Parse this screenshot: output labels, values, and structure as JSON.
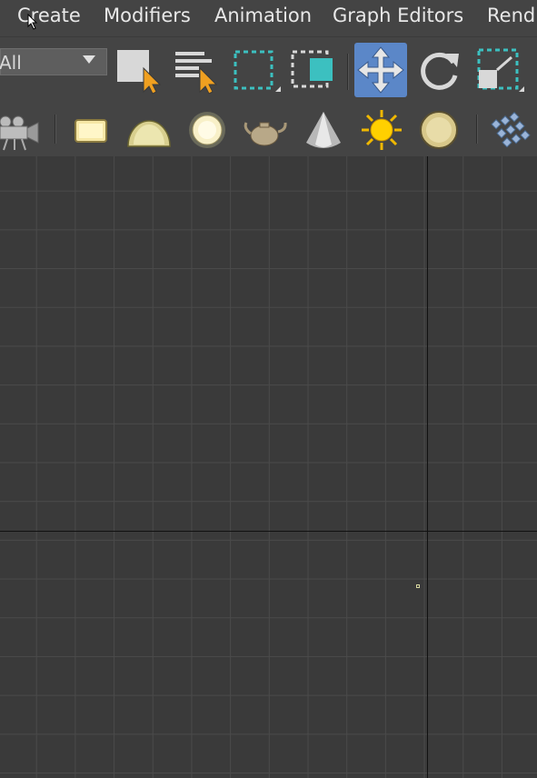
{
  "menu": {
    "items": [
      "Create",
      "Modifiers",
      "Animation",
      "Graph Editors",
      "Rend"
    ]
  },
  "toolbar": {
    "selection_filter": "All",
    "buttons": [
      "select-object-icon",
      "select-by-name-icon",
      "rectangular-selection-region-icon",
      "window-crossing-icon",
      "select-and-move-icon",
      "select-and-rotate-icon",
      "select-and-scale-icon"
    ],
    "active_button": "select-and-move-icon",
    "accent_color": "#5b87c8"
  },
  "create_toolbar": {
    "icons": [
      "camera-icon",
      "free-light-icon",
      "skylight-icon",
      "omni-light-icon",
      "teapot-icon",
      "spotlight-icon",
      "sun-icon",
      "photometric-light-icon",
      "array-icon"
    ]
  },
  "viewport": {
    "background": "#3a3a3a",
    "grid_color": "#4a4a4a"
  }
}
